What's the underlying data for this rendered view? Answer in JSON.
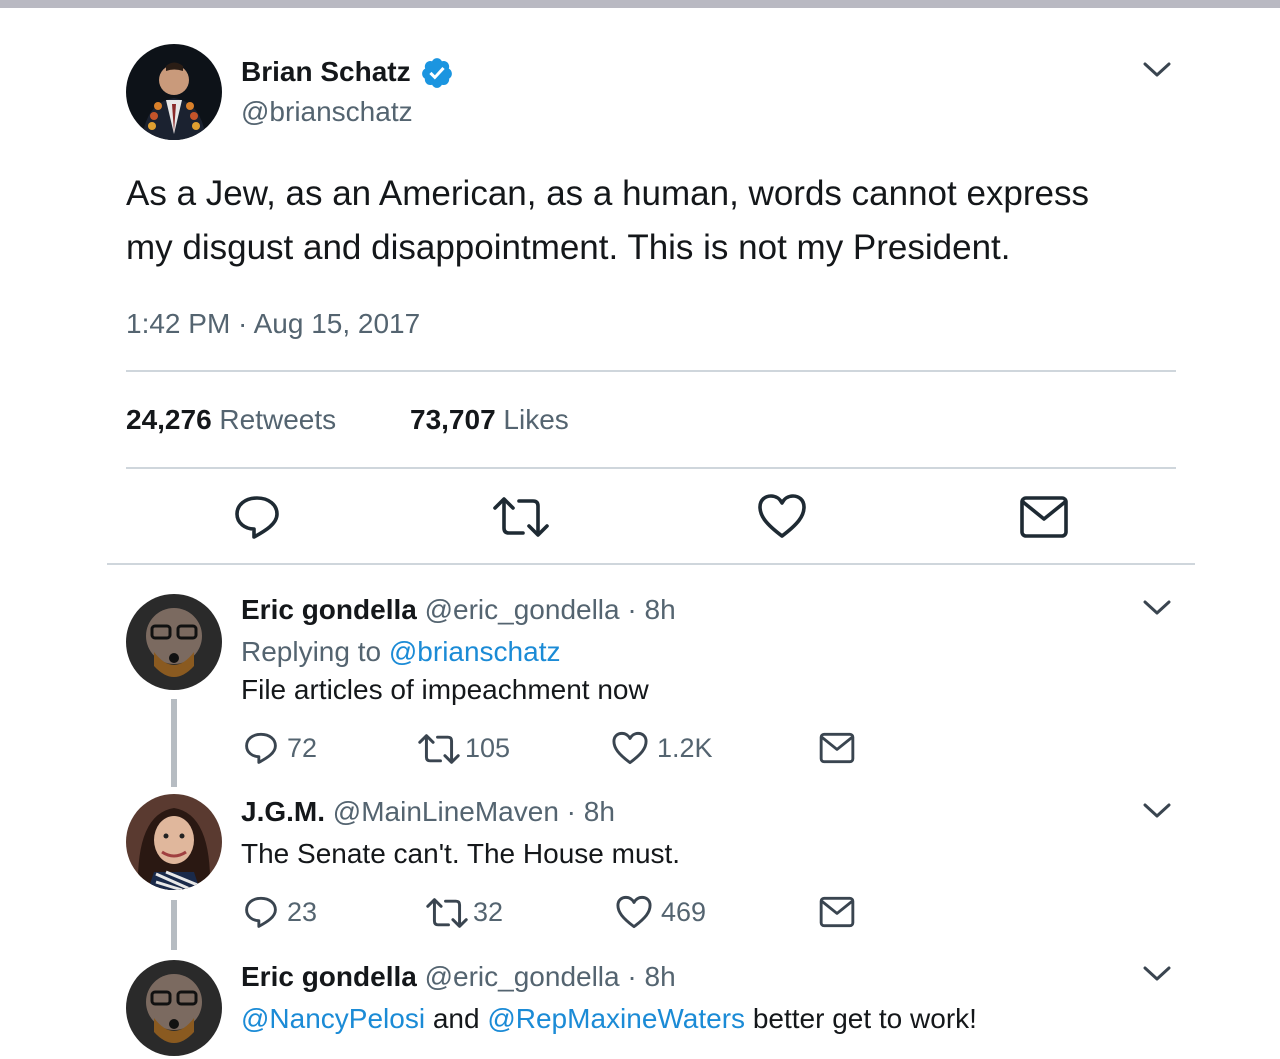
{
  "main_tweet": {
    "name": "Brian Schatz",
    "handle": "@brianschatz",
    "text_line1": "As a Jew, as an American, as a human, words cannot express",
    "text_line2": "my disgust and disappointment. This is not my President.",
    "timestamp": "1:42 PM · Aug 15, 2017",
    "retweets_count": "24,276",
    "retweets_label": "Retweets",
    "likes_count": "73,707",
    "likes_label": "Likes"
  },
  "replies": [
    {
      "name": "Eric gondella",
      "handle": "@eric_gondella",
      "time": "· 8h",
      "replying_label": "Replying to",
      "replying_to": "@brianschatz",
      "text": "File articles of impeachment now",
      "replies": "72",
      "retweets": "105",
      "likes": "1.2K"
    },
    {
      "name": "J.G.M.",
      "handle": "@MainLineMaven",
      "time": "· 8h",
      "text": "The Senate can't. The House must.",
      "replies": "23",
      "retweets": "32",
      "likes": "469"
    },
    {
      "name": "Eric gondella",
      "handle": "@eric_gondella",
      "time": "· 8h",
      "mention1": "@NancyPelosi",
      "and_text": "and",
      "mention2": "@RepMaxineWaters",
      "rest_text": "better get to work!"
    }
  ],
  "colors": {
    "verified": "#1b95e0",
    "link": "#1b8bd6",
    "muted": "#546470",
    "text": "#14171a"
  },
  "icons": [
    "verified-badge-icon",
    "chevron-down-icon",
    "reply-icon",
    "retweet-icon",
    "like-icon",
    "message-icon"
  ]
}
